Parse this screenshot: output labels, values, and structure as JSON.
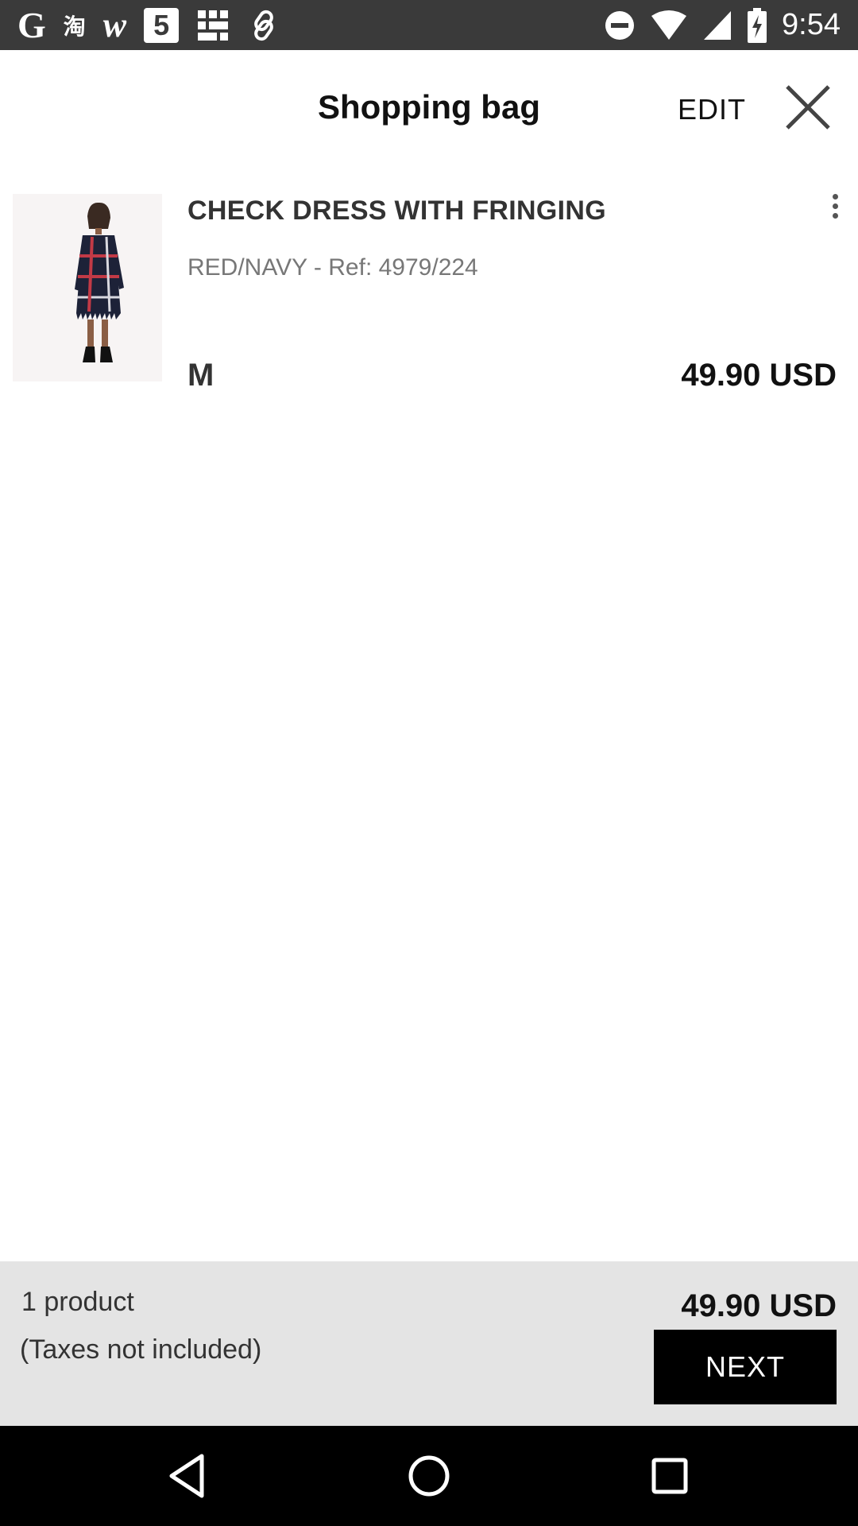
{
  "status_bar": {
    "time": "9:54",
    "left_icons": [
      "google-icon",
      "taobao-icon",
      "wish-icon",
      "html5-icon",
      "grid-app-icon",
      "link-icon"
    ],
    "right_icons": [
      "do-not-disturb-icon",
      "wifi-icon",
      "signal-icon",
      "battery-charging-icon"
    ],
    "g_glyph": "G",
    "tao_glyph": "淘",
    "w_glyph": "w",
    "five_glyph": "5"
  },
  "header": {
    "title": "Shopping bag",
    "edit_label": "EDIT"
  },
  "cart": {
    "items": [
      {
        "name": "CHECK DRESS WITH FRINGING",
        "details": "RED/NAVY - Ref: 4979/224",
        "size": "M",
        "price": "49.90 USD"
      }
    ]
  },
  "summary": {
    "count": "1 product",
    "taxes_note": "(Taxes not included)",
    "total": "49.90 USD",
    "next_label": "NEXT"
  },
  "colors": {
    "status_bar": "#3a3a3a",
    "footer": "#e4e4e4",
    "button": "#000000",
    "nav_bar": "#000000"
  }
}
